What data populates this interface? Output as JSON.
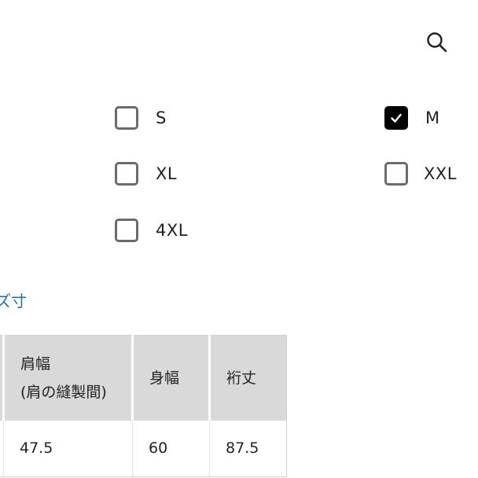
{
  "header": {
    "search_icon": "search-icon"
  },
  "size_filter": {
    "options": [
      {
        "label": "S",
        "checked": false
      },
      {
        "label": "M",
        "checked": true
      },
      {
        "label": "XL",
        "checked": false
      },
      {
        "label": "XXL",
        "checked": false
      },
      {
        "label": "4XL",
        "checked": false
      }
    ]
  },
  "size_chart": {
    "link_text": "ズ寸",
    "link_color": "#1f6fb0",
    "headers": {
      "shoulder_line1": "肩幅",
      "shoulder_line2": "(肩の縫製間)",
      "body_width": "身幅",
      "sleeve_length": "裄丈"
    },
    "row": {
      "shoulder": "47.5",
      "body_width": "60",
      "sleeve_length": "87.5"
    }
  }
}
